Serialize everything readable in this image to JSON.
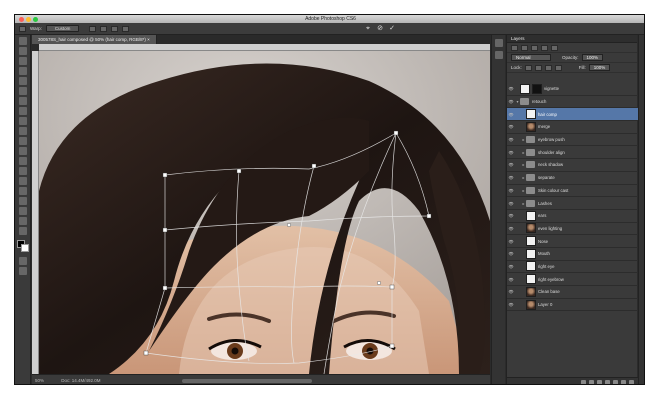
{
  "app": {
    "title": "Adobe Photoshop CS6",
    "traffic_light_colors": [
      "#fc5f57",
      "#fdbc2e",
      "#29c940"
    ]
  },
  "options_bar": {
    "mode_label": "Warp:",
    "mode_value": "Custom",
    "cancel_icon": "cancel-transform-icon",
    "commit_icon": "commit-transform-icon"
  },
  "document": {
    "tab_label": "300578S_hair composed @ 50% (hair comp, RGB/8*) ×",
    "zoom": "50%",
    "doc_size": "Doc: 14.4M/492.0M"
  },
  "layers_panel": {
    "tab": "Layers",
    "blend_mode": "Normal",
    "opacity_label": "Opacity:",
    "opacity_value": "100%",
    "lock_label": "Lock:",
    "fill_label": "Fill:",
    "fill_value": "100%",
    "active_color": "#5577a8",
    "layers": [
      {
        "name": "vignette",
        "type": "mask",
        "expanded": false
      },
      {
        "name": "retouch",
        "type": "group",
        "expanded": true
      },
      {
        "name": "hair comp",
        "type": "white",
        "active": true
      },
      {
        "name": "merge",
        "type": "photo"
      },
      {
        "name": "eyebrow push",
        "type": "group"
      },
      {
        "name": "shoulder align",
        "type": "group"
      },
      {
        "name": "neck shadow",
        "type": "group"
      },
      {
        "name": "separate",
        "type": "group"
      },
      {
        "name": "Skin colour cast",
        "type": "group"
      },
      {
        "name": "Lashes",
        "type": "group"
      },
      {
        "name": "ears",
        "type": "white"
      },
      {
        "name": "even lighting",
        "type": "photo"
      },
      {
        "name": "Nose",
        "type": "white"
      },
      {
        "name": "Mouth",
        "type": "white"
      },
      {
        "name": "right eye",
        "type": "white"
      },
      {
        "name": "right eyebrow",
        "type": "white"
      },
      {
        "name": "Clean base",
        "type": "photo"
      },
      {
        "name": "Layer 0",
        "type": "photo"
      }
    ]
  },
  "canvas": {
    "background_color": "#c7c1bd",
    "hair_color": "#2a1d18",
    "skin_color": "#d8ae92"
  }
}
